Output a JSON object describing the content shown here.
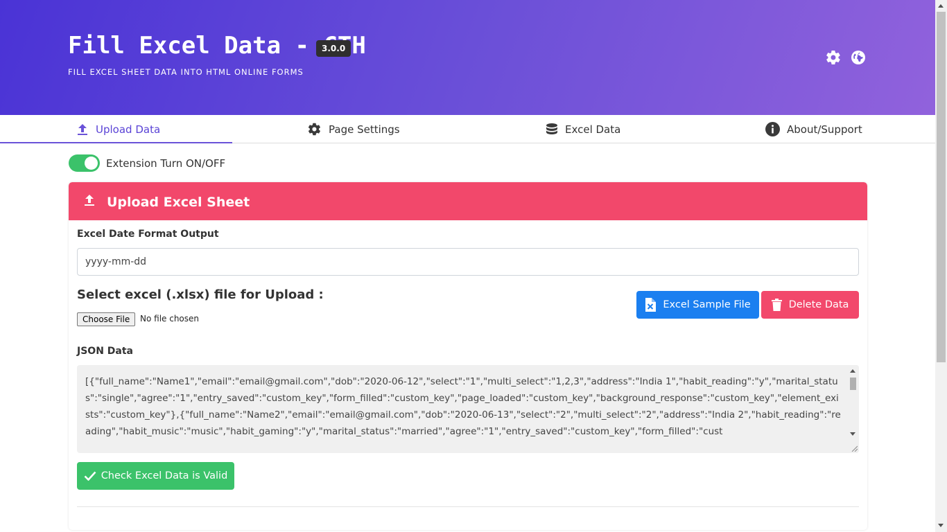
{
  "header": {
    "title": "Fill Excel Data - CTH",
    "version": "3.0.0",
    "subtitle": "FILL EXCEL SHEET DATA INTO HTML ONLINE FORMS",
    "icons": [
      "gear-icon",
      "globe-icon"
    ]
  },
  "tabs": [
    {
      "label": "Upload Data",
      "icon": "upload-icon",
      "active": true
    },
    {
      "label": "Page Settings",
      "icon": "gear-icon",
      "active": false
    },
    {
      "label": "Excel Data",
      "icon": "database-icon",
      "active": false
    },
    {
      "label": "About/Support",
      "icon": "info-icon",
      "active": false
    }
  ],
  "toggle": {
    "label": "Extension Turn ON/OFF",
    "on": true
  },
  "card": {
    "title": "Upload Excel Sheet",
    "date_format_label": "Excel Date Format Output",
    "date_format_value": "yyyy-mm-dd",
    "upload_heading": "Select excel (.xlsx) file for Upload :",
    "file_button": "Choose File",
    "file_status": "No file chosen",
    "sample_button": "Excel Sample File",
    "delete_button": "Delete Data",
    "json_label": "JSON Data",
    "json_value": "[{\"full_name\":\"Name1\",\"email\":\"email@gmail.com\",\"dob\":\"2020-06-12\",\"select\":\"1\",\"multi_select\":\"1,2,3\",\"address\":\"India 1\",\"habit_reading\":\"y\",\"marital_status\":\"single\",\"agree\":\"1\",\"entry_saved\":\"custom_key\",\"form_filled\":\"custom_key\",\"page_loaded\":\"custom_key\",\"background_response\":\"custom_key\",\"element_exists\":\"custom_key\"},{\"full_name\":\"Name2\",\"email\":\"email@gmail.com\",\"dob\":\"2020-06-13\",\"select\":\"2\",\"multi_select\":\"2\",\"address\":\"India 2\",\"habit_reading\":\"reading\",\"habit_music\":\"music\",\"habit_gaming\":\"y\",\"marital_status\":\"married\",\"agree\":\"1\",\"entry_saved\":\"custom_key\",\"form_filled\":\"cust",
    "check_button": "Check Excel Data is Valid"
  },
  "colors": {
    "header_gradient_start": "#4a33d6",
    "header_gradient_end": "#9162dc",
    "card_header": "#f2486b",
    "primary_blue": "#1b7ff0",
    "success_green": "#3bc26a",
    "active_tab": "#5a43d6"
  }
}
